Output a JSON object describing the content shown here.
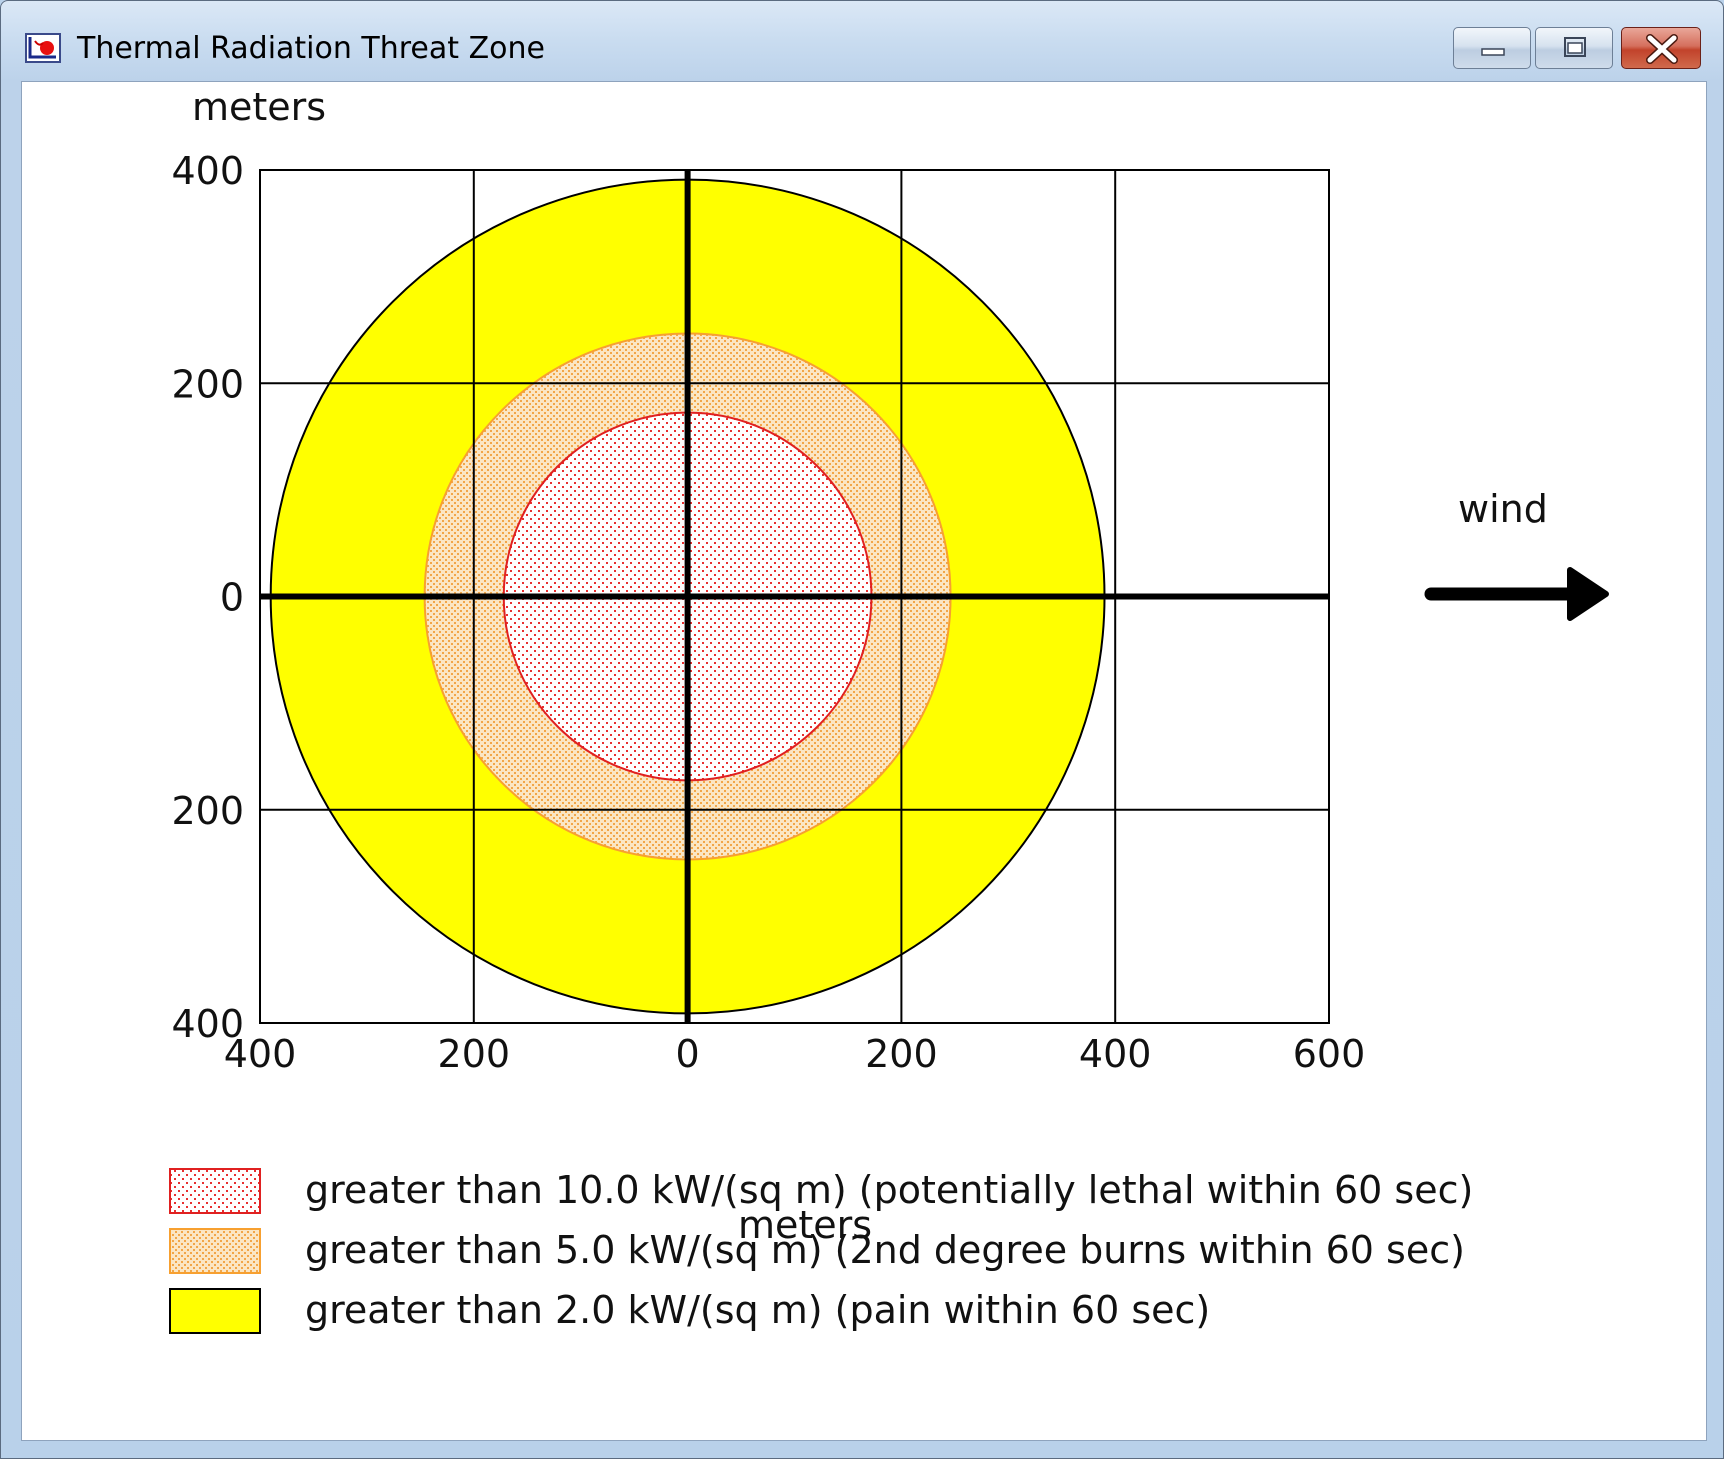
{
  "window": {
    "title": "Thermal Radiation Threat Zone",
    "icon": "aloha-app-icon",
    "buttons": [
      "minimize-icon",
      "maximize-icon",
      "close-icon"
    ]
  },
  "chart_data": {
    "type": "threat-zone",
    "y_unit_label": "meters",
    "x_unit_label": "meters",
    "x_ticks": [
      "400",
      "200",
      "0",
      "200",
      "400",
      "600"
    ],
    "y_ticks": [
      "400",
      "200",
      "0",
      "200",
      "400"
    ],
    "xlim": [
      -400,
      600
    ],
    "ylim": [
      -400,
      400
    ],
    "grid": true,
    "wind_label": "wind",
    "wind_direction": "east",
    "zones": [
      {
        "radius_m": 390,
        "color": "#ffff00",
        "stroke": "#000000",
        "pattern": "solid"
      },
      {
        "radius_m": 246,
        "color": "#f9d9a8",
        "stroke": "#f7a030",
        "pattern": "orange-dots"
      },
      {
        "radius_m": 172,
        "color": "#ffffff",
        "stroke": "#e02020",
        "pattern": "red-dots"
      }
    ],
    "legend": [
      {
        "text": "greater than 10.0 kW/(sq m) (potentially lethal within 60 sec)",
        "swatch": "red-dots",
        "border": "#e02020"
      },
      {
        "text": "greater than 5.0 kW/(sq m) (2nd degree burns within 60 sec)",
        "swatch": "orange-dots",
        "border": "#f7a030"
      },
      {
        "text": "greater than 2.0 kW/(sq m) (pain within 60 sec)",
        "swatch": "yellow",
        "border": "#000000"
      }
    ]
  }
}
